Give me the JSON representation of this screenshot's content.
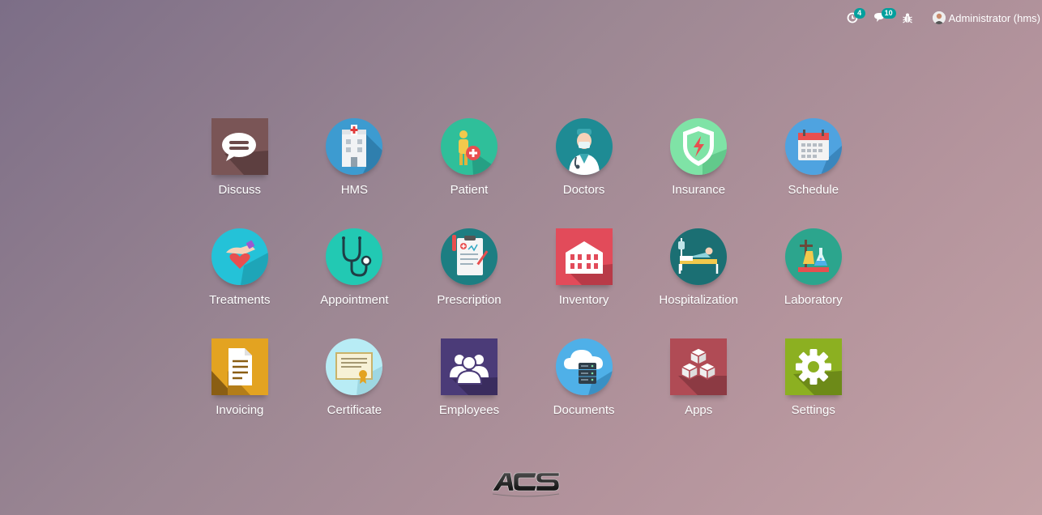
{
  "systray": {
    "activity_count": "4",
    "messages_count": "10",
    "user_name": "Administrator (hms)"
  },
  "apps": [
    {
      "label": "Discuss",
      "icon": "chat-bubble-icon",
      "color": "#6b4a4a"
    },
    {
      "label": "HMS",
      "icon": "hospital-building-icon",
      "color": "#3d9bd0"
    },
    {
      "label": "Patient",
      "icon": "patient-icon",
      "color": "#2fbf9a"
    },
    {
      "label": "Doctors",
      "icon": "doctor-icon",
      "color": "#1e8b94"
    },
    {
      "label": "Insurance",
      "icon": "shield-icon",
      "color": "#7fe3a6"
    },
    {
      "label": "Schedule",
      "icon": "calendar-icon",
      "color": "#4fa3e0"
    },
    {
      "label": "Treatments",
      "icon": "hand-heart-icon",
      "color": "#24c2d8"
    },
    {
      "label": "Appointment",
      "icon": "stethoscope-icon",
      "color": "#22c9b3"
    },
    {
      "label": "Prescription",
      "icon": "clipboard-icon",
      "color": "#1d7e82"
    },
    {
      "label": "Inventory",
      "icon": "warehouse-icon",
      "color": "#e24b5a"
    },
    {
      "label": "Hospitalization",
      "icon": "hospital-bed-icon",
      "color": "#1b6f73"
    },
    {
      "label": "Laboratory",
      "icon": "lab-flask-icon",
      "color": "#2ca58d"
    },
    {
      "label": "Invoicing",
      "icon": "document-icon",
      "color": "#e3a321"
    },
    {
      "label": "Certificate",
      "icon": "certificate-icon",
      "color": "#b8ecf5"
    },
    {
      "label": "Employees",
      "icon": "people-icon",
      "color": "#4b3b78"
    },
    {
      "label": "Documents",
      "icon": "cloud-server-icon",
      "color": "#4fb0e8"
    },
    {
      "label": "Apps",
      "icon": "cubes-icon",
      "color": "#b04b55"
    },
    {
      "label": "Settings",
      "icon": "gear-icon",
      "color": "#8cb021"
    }
  ],
  "footer": {
    "logo_text": "ACS"
  }
}
